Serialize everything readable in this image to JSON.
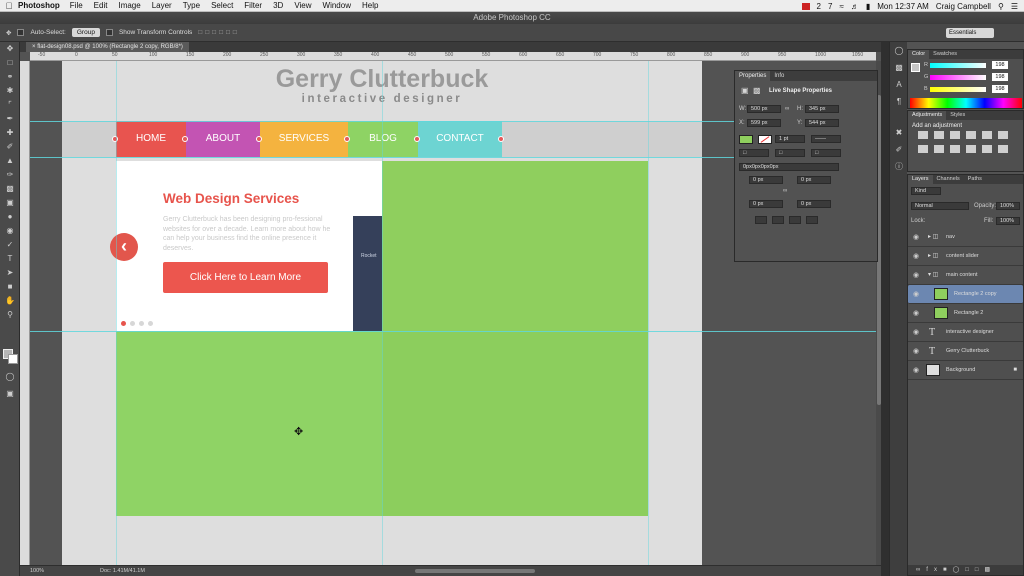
{
  "menubar": {
    "app": "Photoshop",
    "items": [
      "File",
      "Edit",
      "Image",
      "Layer",
      "Type",
      "Select",
      "Filter",
      "3D",
      "View",
      "Window",
      "Help"
    ],
    "right": {
      "badge1": "2",
      "badge2": "7",
      "clock": "Mon 12:37 AM",
      "user": "Craig Campbell"
    }
  },
  "window": {
    "title": "Adobe Photoshop CC"
  },
  "options": {
    "auto_select": "Auto-Select:",
    "group": "Group",
    "show_transform": "Show Transform Controls",
    "workspace": "Essentials"
  },
  "document": {
    "tab": "flat-design08.psd @ 100% (Rectangle 2 copy, RGB/8*)",
    "zoom": "100%",
    "doc_size": "Doc: 1.41M/41.1M",
    "ruler_ticks": [
      "-50",
      "0",
      "50",
      "100",
      "150",
      "200",
      "250",
      "300",
      "350",
      "400",
      "450",
      "500",
      "550",
      "600",
      "650",
      "700",
      "750",
      "800",
      "850",
      "900",
      "950",
      "1000",
      "1050"
    ]
  },
  "site": {
    "logo_title": "Gerry Clutterbuck",
    "logo_sub": "interactive designer",
    "nav": [
      {
        "label": "HOME",
        "color": "#e8544f"
      },
      {
        "label": "ABOUT",
        "color": "#c354b3"
      },
      {
        "label": "SERVICES",
        "color": "#f4b33f"
      },
      {
        "label": "BLOG",
        "color": "#8ed364"
      },
      {
        "label": "CONTACT",
        "color": "#6dd4d2"
      }
    ],
    "slide": {
      "heading": "Web Design Services",
      "body": "Gerry Clutterbuck has been designing pro-fessional websites for over a decade. Learn more about how he can help your business find the online presence it deserves.",
      "button": "Click Here to Learn More",
      "phone_text": "Rocket"
    }
  },
  "properties": {
    "tabs": [
      "Properties",
      "Info"
    ],
    "title": "Live Shape Properties",
    "W": "500 px",
    "H": "345 px",
    "X": "599 px",
    "Y": "544 px",
    "stroke_width": "1 pt",
    "radius_label": "0px0px0px0px",
    "r1": "0 px",
    "r2": "0 px",
    "r3": "0 px",
    "r4": "0 px"
  },
  "color_panel": {
    "tabs": [
      "Color",
      "Swatches"
    ],
    "R": "198",
    "G": "198",
    "B": "198"
  },
  "adjustments": {
    "tabs": [
      "Adjustments",
      "Styles"
    ],
    "add": "Add an adjustment"
  },
  "layers_panel": {
    "tabs": [
      "Layers",
      "Channels",
      "Paths"
    ],
    "kind": "Kind",
    "blend": "Normal",
    "opacity_label": "Opacity:",
    "opacity": "100%",
    "lock_label": "Lock:",
    "fill_label": "Fill:",
    "fill": "100%",
    "layers": [
      {
        "name": "nav",
        "kind": "folder"
      },
      {
        "name": "content slider",
        "kind": "folder"
      },
      {
        "name": "main content",
        "kind": "folder-open"
      },
      {
        "name": "Rectangle 2 copy",
        "kind": "shape",
        "selected": true
      },
      {
        "name": "Rectangle 2",
        "kind": "shape"
      },
      {
        "name": "interactive designer",
        "kind": "text"
      },
      {
        "name": "Gerry Clutterbuck",
        "kind": "text"
      },
      {
        "name": "Background",
        "kind": "background"
      }
    ]
  }
}
